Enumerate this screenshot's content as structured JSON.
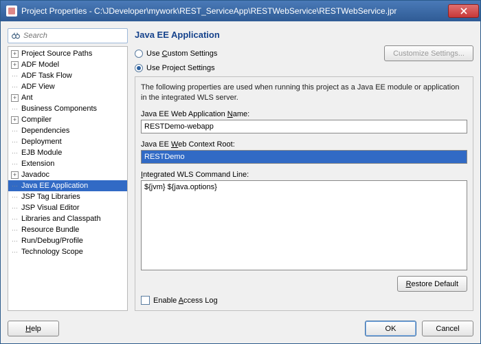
{
  "window": {
    "title": "Project Properties - C:\\JDeveloper\\mywork\\REST_ServiceApp\\RESTWebService\\RESTWebService.jpr"
  },
  "search": {
    "placeholder": "Search"
  },
  "tree": {
    "items": [
      {
        "label": "Project Source Paths",
        "exp": "+"
      },
      {
        "label": "ADF Model",
        "exp": "+"
      },
      {
        "label": "ADF Task Flow",
        "dots": true
      },
      {
        "label": "ADF View",
        "dots": true
      },
      {
        "label": "Ant",
        "exp": "+"
      },
      {
        "label": "Business Components",
        "dots": true
      },
      {
        "label": "Compiler",
        "exp": "+"
      },
      {
        "label": "Dependencies",
        "dots": true
      },
      {
        "label": "Deployment",
        "dots": true
      },
      {
        "label": "EJB Module",
        "dots": true
      },
      {
        "label": "Extension",
        "dots": true
      },
      {
        "label": "Javadoc",
        "exp": "+"
      },
      {
        "label": "Java EE Application",
        "dots": true,
        "selected": true
      },
      {
        "label": "JSP Tag Libraries",
        "dots": true
      },
      {
        "label": "JSP Visual Editor",
        "dots": true
      },
      {
        "label": "Libraries and Classpath",
        "dots": true
      },
      {
        "label": "Resource Bundle",
        "dots": true
      },
      {
        "label": "Run/Debug/Profile",
        "dots": true
      },
      {
        "label": "Technology Scope",
        "dots": true
      }
    ]
  },
  "panel": {
    "title": "Java EE Application",
    "use_custom": "Use Custom Settings",
    "use_custom_pre": "Use ",
    "use_custom_u": "C",
    "use_custom_post": "ustom Settings",
    "use_project": "Use Project Settings",
    "customize_btn": "Customize Settings...",
    "description": "The following properties are used when running this project as a Java EE module or application in the integrated WLS server.",
    "name_label_pre": "Java EE Web Application ",
    "name_label_u": "N",
    "name_label_post": "ame:",
    "name_value": "RESTDemo-webapp",
    "ctx_label_pre": "Java EE ",
    "ctx_label_u": "W",
    "ctx_label_post": "eb Context Root:",
    "ctx_value": "RESTDemo",
    "cmd_label_pre": "",
    "cmd_label_u": "I",
    "cmd_label_post": "ntegrated WLS Command Line:",
    "cmd_value": "${jvm} ${java.options}",
    "restore_pre": "",
    "restore_u": "R",
    "restore_post": "estore Default",
    "access_log_pre": "Enable ",
    "access_log_u": "A",
    "access_log_post": "ccess Log"
  },
  "footer": {
    "help_u": "H",
    "help_post": "elp",
    "ok": "OK",
    "cancel": "Cancel"
  }
}
